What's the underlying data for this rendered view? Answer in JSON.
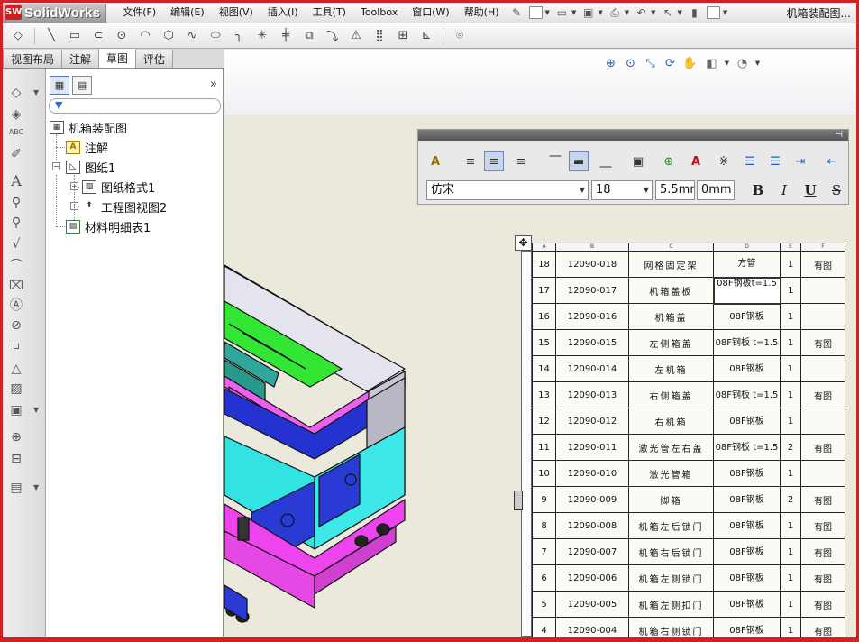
{
  "app": {
    "logo": "SolidWorks",
    "document_title": "机箱装配图..."
  },
  "menu": [
    "文件(F)",
    "编辑(E)",
    "视图(V)",
    "插入(I)",
    "工具(T)",
    "Toolbox",
    "窗口(W)",
    "帮助(H)"
  ],
  "tabs": [
    {
      "label": "视图布局",
      "active": false
    },
    {
      "label": "注解",
      "active": false
    },
    {
      "label": "草图",
      "active": true
    },
    {
      "label": "评估",
      "active": false
    }
  ],
  "tree": {
    "root": "机箱装配图",
    "annotations": "注解",
    "sheet": "图纸1",
    "sheet_format": "图纸格式1",
    "drawing_view": "工程图视图2",
    "bom": "材料明细表1"
  },
  "format_toolbar": {
    "font": "仿宋",
    "size": "18",
    "height": "5.5mm",
    "spacing": "0mm",
    "bold": "B",
    "italic": "I",
    "underline": "U",
    "strike": "S"
  },
  "bom": {
    "columns": [
      "A",
      "B",
      "C",
      "D",
      "E",
      "F"
    ],
    "rows": [
      {
        "no": "18",
        "code": "12090-018",
        "name": "网格固定架",
        "material": "方管",
        "qty": "1",
        "note": "有图"
      },
      {
        "no": "17",
        "code": "12090-017",
        "name": "机箱盖板",
        "material": "08F钢板t=1.5",
        "qty": "1",
        "note": ""
      },
      {
        "no": "16",
        "code": "12090-016",
        "name": "机箱盖",
        "material": "08F钢板",
        "qty": "1",
        "note": ""
      },
      {
        "no": "15",
        "code": "12090-015",
        "name": "左侧箱盖",
        "material": "08F钢板 t=1.5",
        "qty": "1",
        "note": "有图"
      },
      {
        "no": "14",
        "code": "12090-014",
        "name": "左机箱",
        "material": "08F钢板",
        "qty": "1",
        "note": ""
      },
      {
        "no": "13",
        "code": "12090-013",
        "name": "右侧箱盖",
        "material": "08F钢板 t=1.5",
        "qty": "1",
        "note": "有图"
      },
      {
        "no": "12",
        "code": "12090-012",
        "name": "右机箱",
        "material": "08F钢板",
        "qty": "1",
        "note": ""
      },
      {
        "no": "11",
        "code": "12090-011",
        "name": "激光管左右盖",
        "material": "08F钢板 t=1.5",
        "qty": "2",
        "note": "有图"
      },
      {
        "no": "10",
        "code": "12090-010",
        "name": "激光管箱",
        "material": "08F钢板",
        "qty": "1",
        "note": ""
      },
      {
        "no": "9",
        "code": "12090-009",
        "name": "脚箱",
        "material": "08F钢板",
        "qty": "2",
        "note": "有图"
      },
      {
        "no": "8",
        "code": "12090-008",
        "name": "机箱左后锁门",
        "material": "08F钢板",
        "qty": "1",
        "note": "有图"
      },
      {
        "no": "7",
        "code": "12090-007",
        "name": "机箱右后锁门",
        "material": "08F钢板",
        "qty": "1",
        "note": "有图"
      },
      {
        "no": "6",
        "code": "12090-006",
        "name": "机箱左侧锁门",
        "material": "08F钢板",
        "qty": "1",
        "note": "有图"
      },
      {
        "no": "5",
        "code": "12090-005",
        "name": "机箱左侧扣门",
        "material": "08F钢板",
        "qty": "1",
        "note": "有图"
      },
      {
        "no": "4",
        "code": "12090-004",
        "name": "机箱右侧锁门",
        "material": "08F钢板",
        "qty": "1",
        "note": "有图"
      }
    ]
  }
}
